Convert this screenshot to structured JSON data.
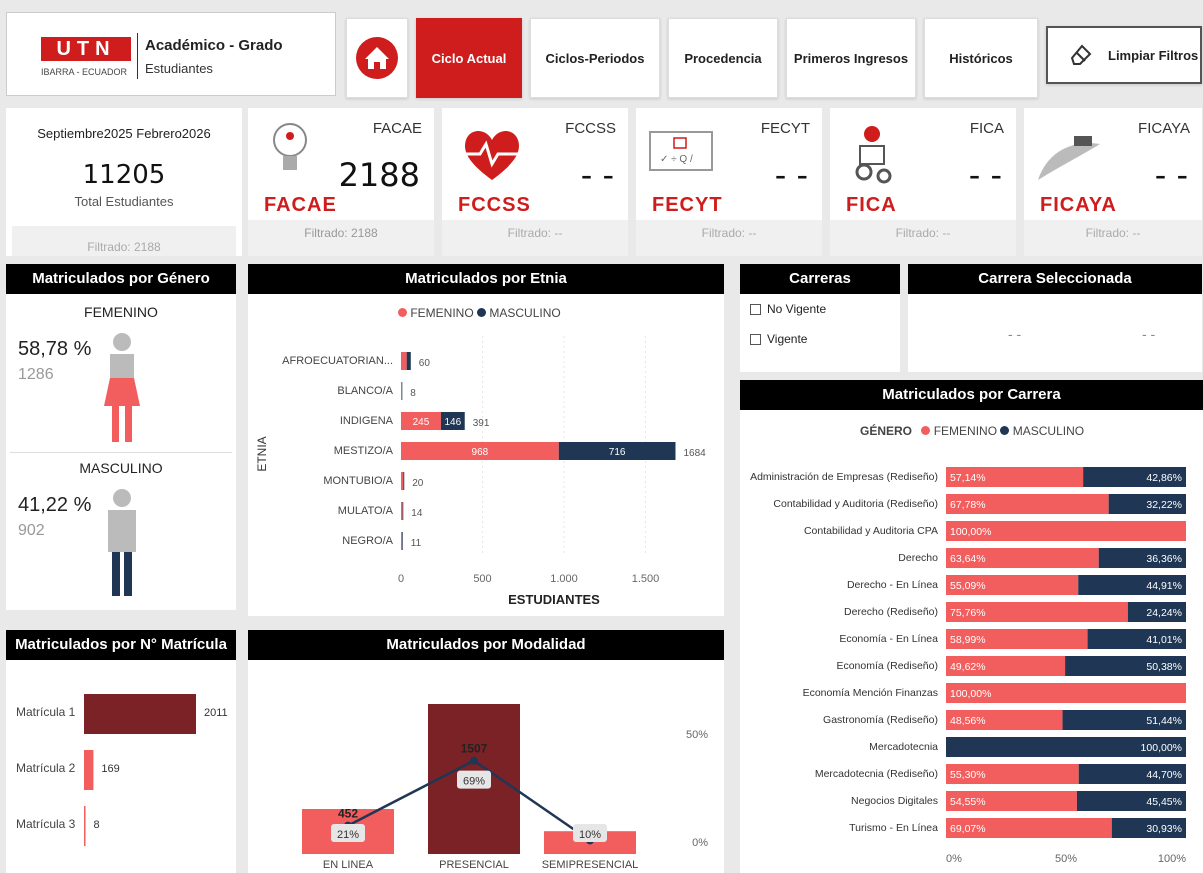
{
  "header": {
    "logo_text": "UTN",
    "logo_sub": "IBARRA - ECUADOR",
    "title": "Académico - Grado",
    "subtitle": "Estudiantes",
    "nav": [
      "Ciclo Actual",
      "Ciclos-Periodos",
      "Procedencia",
      "Primeros Ingresos",
      "Históricos"
    ],
    "clear_filters": "Limpiar Filtros"
  },
  "summary": {
    "period": "Septiembre2025 Febrero2026",
    "total": "11205",
    "total_label": "Total Estudiantes",
    "filtered": "Filtrado: 2188"
  },
  "faculties": [
    {
      "name": "FACAE",
      "value": "2188",
      "logo": "FACAE",
      "filtered": "Filtrado: 2188"
    },
    {
      "name": "FCCSS",
      "value": "- -",
      "logo": "FCCSS",
      "filtered": "Filtrado: --"
    },
    {
      "name": "FECYT",
      "value": "- -",
      "logo": "FECYT",
      "filtered": "Filtrado: --"
    },
    {
      "name": "FICA",
      "value": "- -",
      "logo": "FICA",
      "filtered": "Filtrado: --"
    },
    {
      "name": "FICAYA",
      "value": "- -",
      "logo": "FICAYA",
      "filtered": "Filtrado: --"
    }
  ],
  "colors": {
    "femenino": "#f25d5d",
    "masculino": "#1f3654",
    "accent": "#cf1c1c",
    "dark_red": "#7b2226"
  },
  "gender": {
    "title": "Matriculados por Género",
    "fem_label": "FEMENINO",
    "fem_pct": "58,78 %",
    "fem_count": "1286",
    "mas_label": "MASCULINO",
    "mas_pct": "41,22 %",
    "mas_count": "902"
  },
  "carreras_filter": {
    "title": "Carreras",
    "options": [
      "No Vigente",
      "Vigente"
    ]
  },
  "carrera_sel": {
    "title": "Carrera Seleccionada",
    "v1": "- -",
    "v2": "- -"
  },
  "etnia_chart": {
    "title": "Matriculados por Etnia",
    "legend_f": "FEMENINO",
    "legend_m": "MASCULINO",
    "ylabel": "ETNIA",
    "xlabel": "ESTUDIANTES",
    "xticks": [
      "0",
      "500",
      "1.000",
      "1.500"
    ]
  },
  "matricula_chart": {
    "title": "Matriculados por N° Matrícula"
  },
  "modalidad_chart": {
    "title": "Matriculados por Modalidad",
    "pct_ticks": [
      "50%",
      "0%"
    ]
  },
  "carrera_chart": {
    "title": "Matriculados por Carrera",
    "legend_title": "GÉNERO",
    "legend_f": "FEMENINO",
    "legend_m": "MASCULINO",
    "xticks": [
      "0%",
      "50%",
      "100%"
    ]
  },
  "chart_data": [
    {
      "type": "bar",
      "title": "Matriculados por Etnia",
      "xlabel": "ESTUDIANTES",
      "ylabel": "ETNIA",
      "xlim": [
        0,
        1684
      ],
      "categories": [
        "AFROECUATORIAN...",
        "BLANCO/A",
        "INDIGENA",
        "MESTIZO/A",
        "MONTUBIO/A",
        "MULATO/A",
        "NEGRO/A"
      ],
      "series": [
        {
          "name": "FEMENINO",
          "values": [
            35,
            5,
            245,
            968,
            15,
            10,
            7
          ]
        },
        {
          "name": "MASCULINO",
          "values": [
            25,
            3,
            146,
            716,
            5,
            4,
            4
          ]
        }
      ],
      "totals": [
        60,
        8,
        391,
        1684,
        20,
        14,
        11
      ],
      "seg_labels_f": [
        "",
        "",
        "245",
        "968",
        "",
        "",
        ""
      ],
      "seg_labels_m": [
        "",
        "",
        "146",
        "716",
        "",
        "",
        ""
      ]
    },
    {
      "type": "bar",
      "title": "Matriculados por N° Matrícula",
      "categories": [
        "Matrícula 1",
        "Matrícula 2",
        "Matrícula 3"
      ],
      "values": [
        2011,
        169,
        8
      ]
    },
    {
      "type": "bar",
      "title": "Matriculados por Modalidad",
      "categories": [
        "EN LINEA",
        "PRESENCIAL",
        "SEMIPRESENCIAL"
      ],
      "values": [
        452,
        1507,
        229
      ],
      "percent_labels": [
        "21%",
        "69%",
        "10%"
      ],
      "percent": [
        21,
        69,
        10
      ]
    },
    {
      "type": "bar",
      "title": "Matriculados por Carrera",
      "categories": [
        "Administración de Empresas (Rediseño)",
        "Contabilidad y Auditoria (Rediseño)",
        "Contabilidad y Auditoria CPA",
        "Derecho",
        "Derecho - En Línea",
        "Derecho (Rediseño)",
        "Economía - En Línea",
        "Economía (Rediseño)",
        "Economía Mención Finanzas",
        "Gastronomía (Rediseño)",
        "Mercadotecnia",
        "Mercadotecnia (Rediseño)",
        "Negocios Digitales",
        "Turismo - En Línea"
      ],
      "series": [
        {
          "name": "FEMENINO",
          "values": [
            57.14,
            67.78,
            100,
            63.64,
            55.09,
            75.76,
            58.99,
            49.62,
            100,
            48.56,
            0,
            55.3,
            54.55,
            69.07
          ]
        },
        {
          "name": "MASCULINO",
          "values": [
            42.86,
            32.22,
            0,
            36.36,
            44.91,
            24.24,
            41.01,
            50.38,
            0,
            51.44,
            100,
            44.7,
            45.45,
            30.93
          ]
        }
      ],
      "labels_f": [
        "57,14%",
        "67,78%",
        "100,00%",
        "63,64%",
        "55,09%",
        "75,76%",
        "58,99%",
        "49,62%",
        "100,00%",
        "48,56%",
        "",
        "55,30%",
        "54,55%",
        "69,07%"
      ],
      "labels_m": [
        "42,86%",
        "32,22%",
        "",
        "36,36%",
        "44,91%",
        "24,24%",
        "41,01%",
        "50,38%",
        "",
        "51,44%",
        "100,00%",
        "44,70%",
        "45,45%",
        "30,93%"
      ],
      "xlim": [
        0,
        100
      ]
    }
  ]
}
